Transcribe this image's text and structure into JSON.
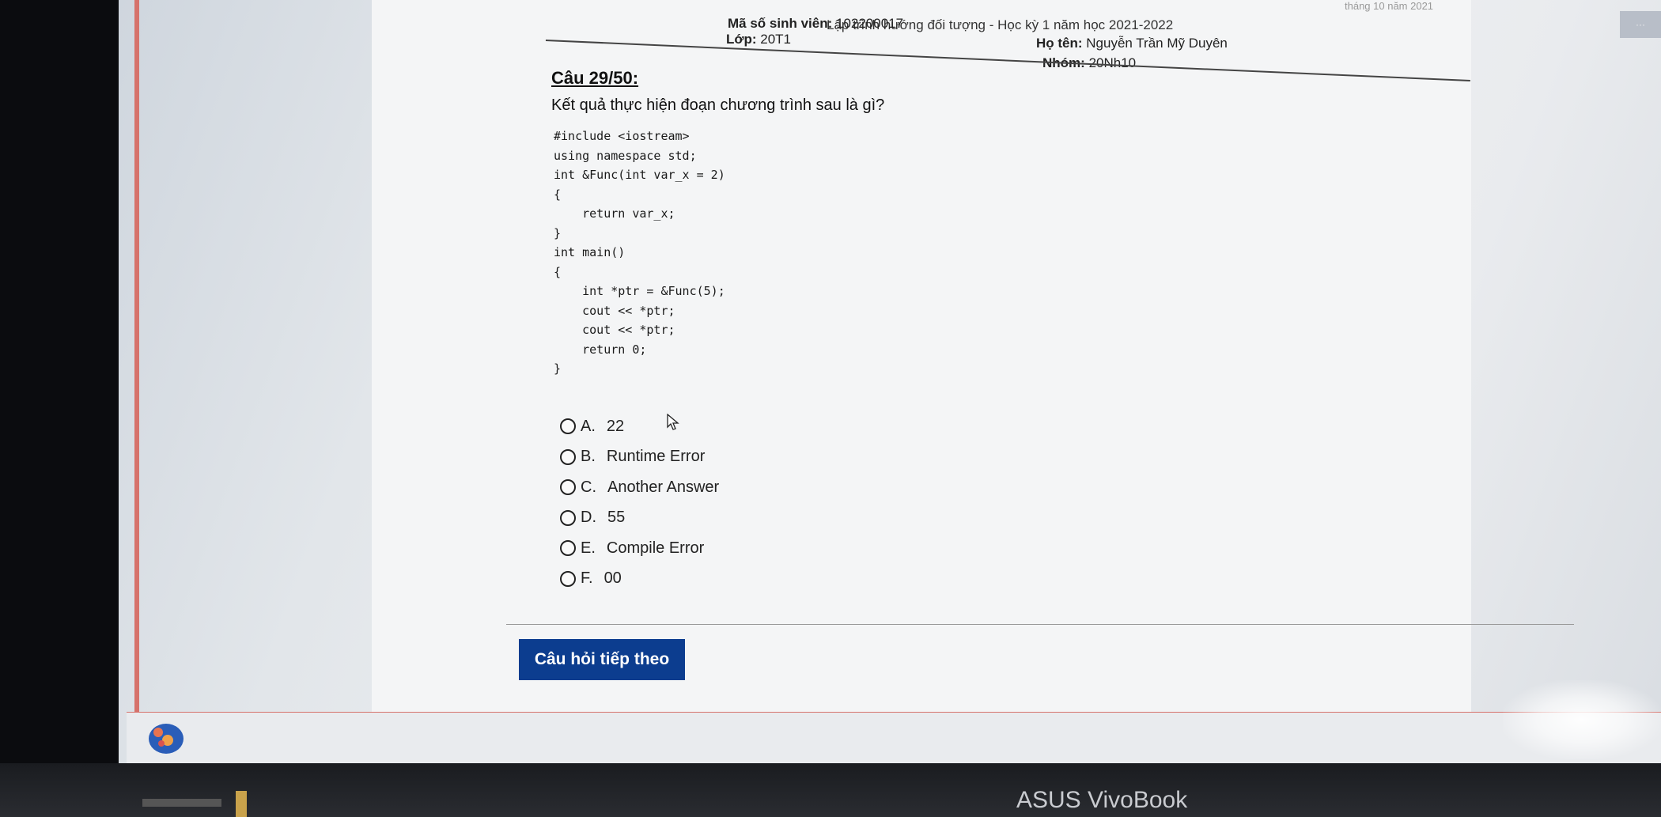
{
  "header": {
    "course_caption": "Lập trình hướng đối tượng - Học kỳ 1 năm học 2021-2022",
    "date_caption": "tháng 10 năm 2021",
    "student_id_label": "Mã số sinh viên:",
    "student_id_value": "102200017",
    "class_label": "Lớp:",
    "class_value": "20T1",
    "name_label": "Họ tên:",
    "name_value": "Nguyễn Trần Mỹ Duyên",
    "group_label": "Nhóm:",
    "group_value": "20Nh10"
  },
  "question": {
    "number": "Câu 29/50:",
    "text": "Kết quả thực hiện đoạn chương trình sau là gì?",
    "code_lines": [
      "#include <iostream>",
      "using namespace std;",
      "int &Func(int var_x = 2)",
      "{",
      "    return var_x;",
      "}",
      "int main()",
      "{",
      "    int *ptr = &Func(5);",
      "    cout << *ptr;",
      "    cout << *ptr;",
      "    return 0;",
      "}"
    ],
    "options": [
      {
        "letter": "A.",
        "text": "22"
      },
      {
        "letter": "B.",
        "text": "Runtime Error"
      },
      {
        "letter": "C.",
        "text": "Another Answer"
      },
      {
        "letter": "D.",
        "text": "55"
      },
      {
        "letter": "E.",
        "text": "Compile Error"
      },
      {
        "letter": "F.",
        "text": "00"
      }
    ]
  },
  "next_button_label": "Câu hỏi tiếp theo",
  "laptop_brand": "ASUS VivoBook",
  "colors": {
    "button": "#0c3d8f",
    "page_edge": "#d6726b"
  }
}
